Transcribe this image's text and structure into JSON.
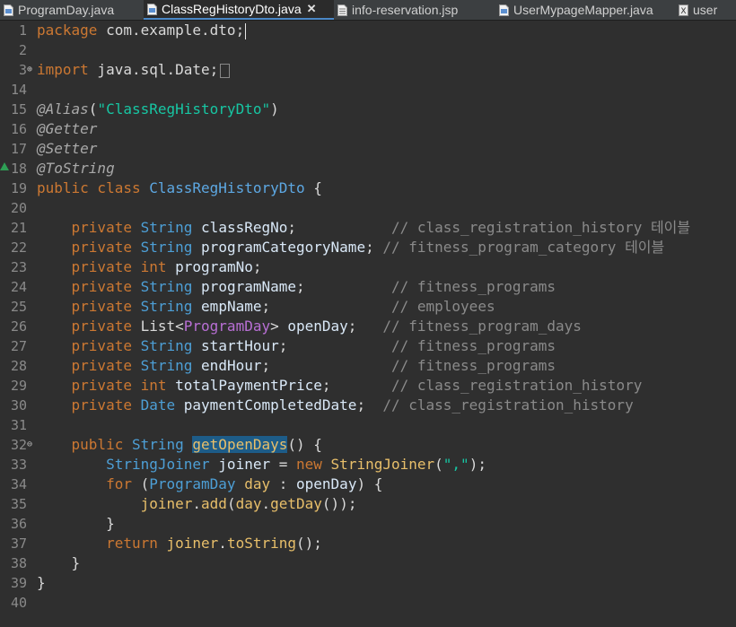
{
  "tabs": [
    {
      "label": "ProgramDay.java",
      "icon": "java-file-icon",
      "active": false
    },
    {
      "label": "ClassRegHistoryDto.java",
      "icon": "java-file-icon",
      "active": true
    },
    {
      "label": "info-reservation.jsp",
      "icon": "jsp-file-icon",
      "active": false
    },
    {
      "label": "UserMypageMapper.java",
      "icon": "java-file-icon",
      "active": false
    },
    {
      "label": "user",
      "icon": "xml-file-icon",
      "active": false
    }
  ],
  "close_symbol": "✕",
  "colors": {
    "keyword": "#cc7832",
    "type": "#4d9fd6",
    "string": "#17c6a3",
    "comment": "#8a8a8a",
    "selection": "#1d5c88"
  },
  "lines": [
    {
      "n": "1",
      "html": "<span class=\"kw\">package</span> com.example.dto;<span class=\"caret\"></span>"
    },
    {
      "n": "2",
      "html": ""
    },
    {
      "n": "3",
      "fold": "⊕",
      "html": "<span class=\"kw\">import</span> java.sql.Date;<span class=\"foldbox\"></span>"
    },
    {
      "n": "14",
      "html": ""
    },
    {
      "n": "15",
      "html": "<span class=\"ann\">@Alias</span>(<span class=\"str\">\"ClassRegHistoryDto\"</span>)"
    },
    {
      "n": "16",
      "html": "<span class=\"ann\">@Getter</span>"
    },
    {
      "n": "17",
      "html": "<span class=\"ann\">@Setter</span>"
    },
    {
      "n": "18",
      "warn": true,
      "html": "<span class=\"ann\">@ToString</span>"
    },
    {
      "n": "19",
      "html": "<span class=\"kw\">public class</span> <span class=\"cls\">ClassRegHistoryDto</span> {"
    },
    {
      "n": "20",
      "html": ""
    },
    {
      "n": "21",
      "html": "    <span class=\"kw\">private</span> <span class=\"ty\">String</span> <span class=\"var\">classRegNo</span>;           <span class=\"cm\">// class_registration_history 테이블</span>"
    },
    {
      "n": "22",
      "html": "    <span class=\"kw\">private</span> <span class=\"ty\">String</span> <span class=\"var\">programCategoryName</span>; <span class=\"cm\">// fitness_program_category 테이블</span>"
    },
    {
      "n": "23",
      "html": "    <span class=\"kw\">private</span> <span class=\"kw\">int</span> <span class=\"var\">programNo</span>;"
    },
    {
      "n": "24",
      "html": "    <span class=\"kw\">private</span> <span class=\"ty\">String</span> <span class=\"var\">programName</span>;          <span class=\"cm\">// fitness_programs</span>"
    },
    {
      "n": "25",
      "html": "    <span class=\"kw\">private</span> <span class=\"ty\">String</span> <span class=\"var\">empName</span>;              <span class=\"cm\">// employees</span>"
    },
    {
      "n": "26",
      "html": "    <span class=\"kw\">private</span> List&lt;<span class=\"gen\">ProgramDay</span>&gt; <span class=\"var\">openDay</span>;   <span class=\"cm\">// fitness_program_days</span>"
    },
    {
      "n": "27",
      "html": "    <span class=\"kw\">private</span> <span class=\"ty\">String</span> <span class=\"var\">startHour</span>;            <span class=\"cm\">// fitness_programs</span>"
    },
    {
      "n": "28",
      "html": "    <span class=\"kw\">private</span> <span class=\"ty\">String</span> <span class=\"var\">endHour</span>;              <span class=\"cm\">// fitness_programs</span>"
    },
    {
      "n": "29",
      "html": "    <span class=\"kw\">private</span> <span class=\"kw\">int</span> <span class=\"var\">totalPaymentPrice</span>;       <span class=\"cm\">// class_registration_history</span>"
    },
    {
      "n": "30",
      "html": "    <span class=\"kw\">private</span> <span class=\"ty\">Date</span> <span class=\"var\">paymentCompletedDate</span>;  <span class=\"cm\">// class_registration_history</span>"
    },
    {
      "n": "31",
      "html": ""
    },
    {
      "n": "32",
      "fold": "⊖",
      "html": "    <span class=\"kw\">public</span> <span class=\"ty\">String</span> <span class=\"sel\">getOpenDays</span>() {"
    },
    {
      "n": "33",
      "html": "        <span class=\"ty\">StringJoiner</span> <span class=\"var\">joiner</span> = <span class=\"kw\">new</span> <span class=\"fn\">StringJoiner</span>(<span class=\"str\">\",\"</span>);"
    },
    {
      "n": "34",
      "html": "        <span class=\"kw\">for</span> (<span class=\"ty\">ProgramDay</span> <span class=\"fn\">day</span> : <span class=\"var\">openDay</span>) {"
    },
    {
      "n": "35",
      "html": "            <span class=\"fn\">joiner</span>.<span class=\"fn\">add</span>(<span class=\"fn\">day</span>.<span class=\"fn\">getDay</span>());"
    },
    {
      "n": "36",
      "html": "        }"
    },
    {
      "n": "37",
      "html": "        <span class=\"kw\">return</span> <span class=\"fn\">joiner</span>.<span class=\"fn\">toString</span>();"
    },
    {
      "n": "38",
      "html": "    }"
    },
    {
      "n": "39",
      "html": "}"
    },
    {
      "n": "40",
      "html": ""
    }
  ]
}
